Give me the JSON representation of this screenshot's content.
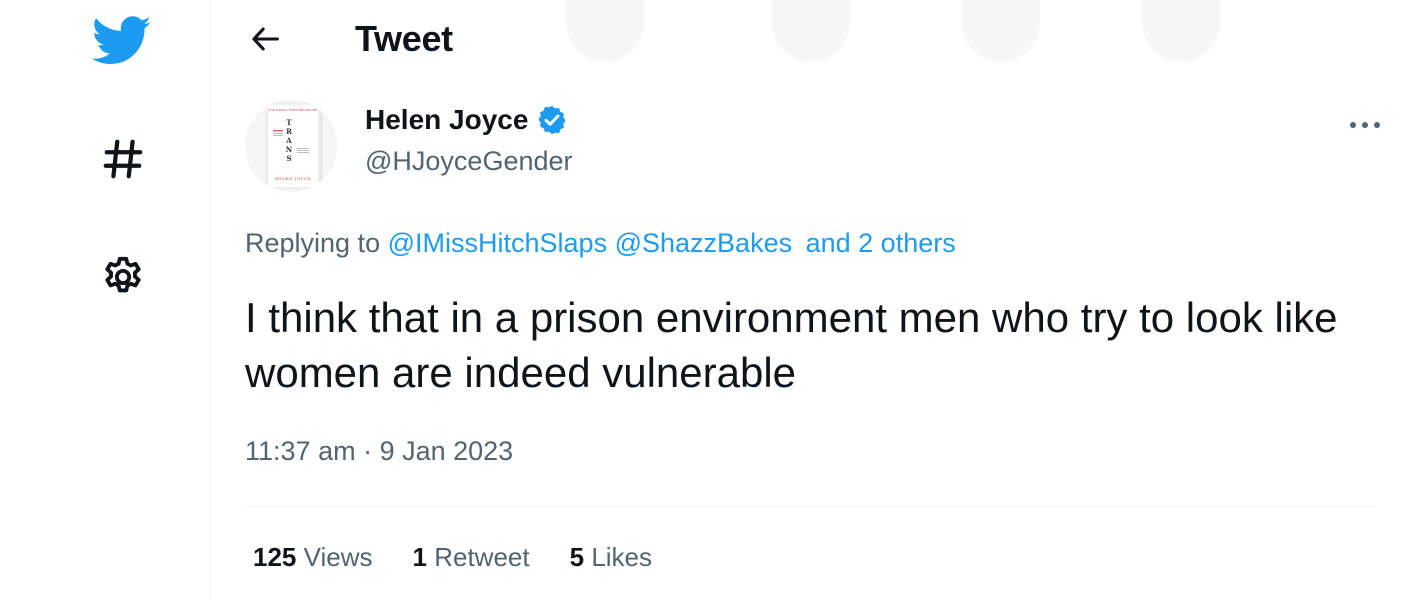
{
  "nav": {
    "items": [
      {
        "icon": "twitter-bird-icon"
      },
      {
        "icon": "hashtag-icon"
      },
      {
        "icon": "gear-icon"
      }
    ]
  },
  "header": {
    "title": "Tweet",
    "back_icon": "arrow-left-icon"
  },
  "tweet": {
    "author": {
      "name": "Helen Joyce",
      "handle": "@HJoyceGender",
      "verified": true,
      "avatar_book_title": "TRANS",
      "avatar_book_author": "HELEN JOYCE"
    },
    "replying_to": {
      "prefix": "Replying to",
      "mention_1": "@IMissHitchSlaps",
      "mention_2": "@ShazzBakes",
      "others": "and 2 others"
    },
    "text": "I think that in a prison environment men who try to look like women are indeed vulnerable",
    "timestamp": "11:37 am · 9 Jan 2023",
    "stats": {
      "views_count": "125",
      "views_label": "Views",
      "retweets_count": "1",
      "retweets_label": "Retweet",
      "likes_count": "5",
      "likes_label": "Likes"
    }
  },
  "colors": {
    "brand_blue": "#1d9bf0",
    "text_primary": "#0f1419",
    "text_secondary": "#536471",
    "divider": "#eff3f4"
  }
}
